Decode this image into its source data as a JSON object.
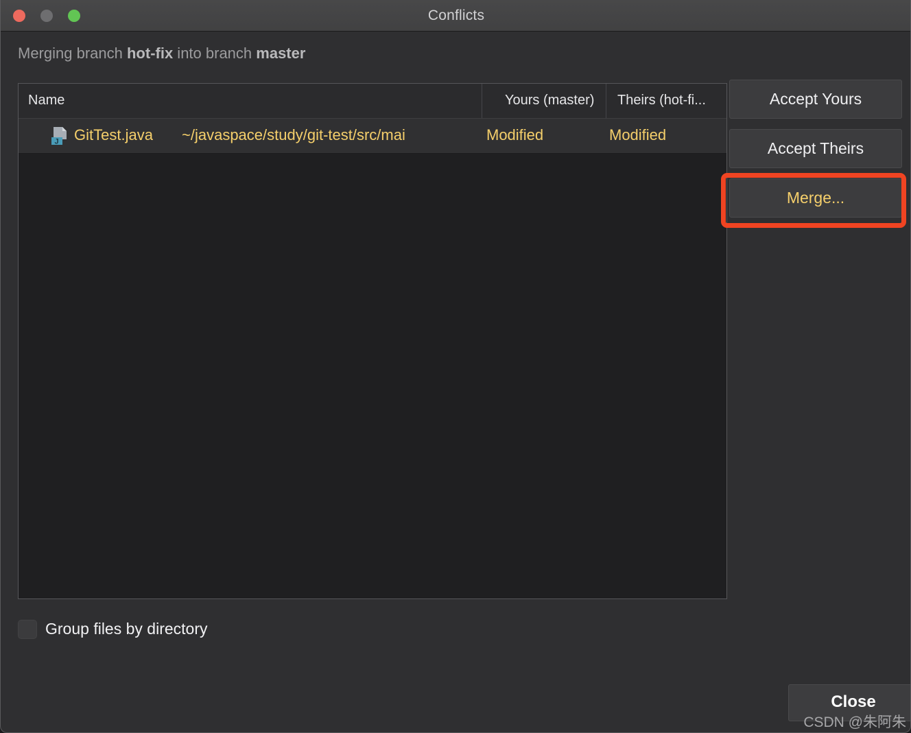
{
  "window": {
    "title": "Conflicts",
    "traffic_lights": [
      "close",
      "minimize",
      "maximize"
    ]
  },
  "subtitle": {
    "prefix": "Merging branch ",
    "source_branch": "hot-fix",
    "middle": " into branch ",
    "target_branch": "master"
  },
  "table": {
    "columns": [
      {
        "key": "name",
        "label": "Name"
      },
      {
        "key": "yours",
        "label": "Yours (master)"
      },
      {
        "key": "theirs",
        "label": "Theirs (hot-fi..."
      }
    ],
    "rows": [
      {
        "icon": "java-file-icon",
        "filename": "GitTest.java",
        "filepath": "~/javaspace/study/git-test/src/mai",
        "yours": "Modified",
        "theirs": "Modified",
        "selected": true
      }
    ]
  },
  "actions": {
    "accept_yours_label": "Accept Yours",
    "accept_theirs_label": "Accept Theirs",
    "merge_label": "Merge...",
    "close_label": "Close"
  },
  "options": {
    "group_files_label": "Group files by directory",
    "group_files_checked": false
  },
  "annotation": {
    "target": "merge-button",
    "color": "#f04422"
  },
  "watermark": {
    "text": "CSDN @朱阿朱"
  },
  "colors": {
    "window_bg": "#2f2f31",
    "titlebar_bg": "#454546",
    "list_bg": "#1f1f21",
    "row_selected_bg": "#303032",
    "accent_yellow": "#f5cf6b",
    "button_bg": "#3c3c3e",
    "highlight_red": "#f04422"
  }
}
